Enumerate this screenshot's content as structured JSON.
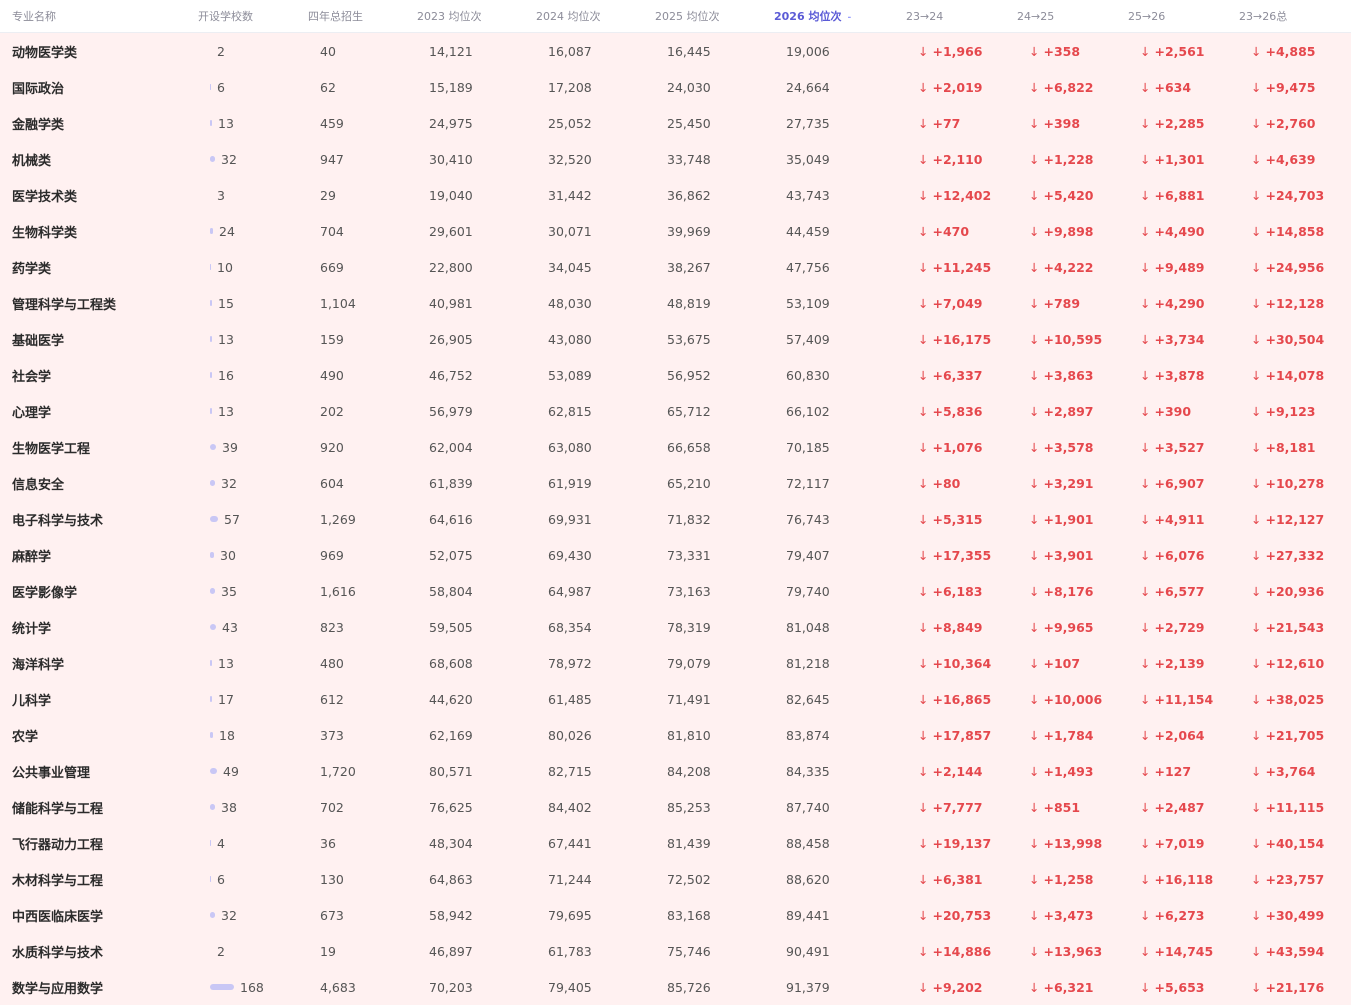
{
  "headers": [
    "专业名称",
    "开设学校数",
    "四年总招生",
    "2023 均位次",
    "2024 均位次",
    "2025 均位次",
    "2026 均位次",
    "23→24",
    "24→25",
    "25→26",
    "23→26总"
  ],
  "sort_indicator": "-",
  "rows": [
    {
      "name": "动物医学类",
      "schools": "2",
      "schools_n": 2,
      "total": "40",
      "r2023": "14,121",
      "r2024": "16,087",
      "r2025": "16,445",
      "r2026": "19,006",
      "d1": "+1,966",
      "d2": "+358",
      "d3": "+2,561",
      "d4": "+4,885"
    },
    {
      "name": "国际政治",
      "schools": "6",
      "schools_n": 6,
      "total": "62",
      "r2023": "15,189",
      "r2024": "17,208",
      "r2025": "24,030",
      "r2026": "24,664",
      "d1": "+2,019",
      "d2": "+6,822",
      "d3": "+634",
      "d4": "+9,475"
    },
    {
      "name": "金融学类",
      "schools": "13",
      "schools_n": 13,
      "total": "459",
      "r2023": "24,975",
      "r2024": "25,052",
      "r2025": "25,450",
      "r2026": "27,735",
      "d1": "+77",
      "d2": "+398",
      "d3": "+2,285",
      "d4": "+2,760"
    },
    {
      "name": "机械类",
      "schools": "32",
      "schools_n": 32,
      "total": "947",
      "r2023": "30,410",
      "r2024": "32,520",
      "r2025": "33,748",
      "r2026": "35,049",
      "d1": "+2,110",
      "d2": "+1,228",
      "d3": "+1,301",
      "d4": "+4,639"
    },
    {
      "name": "医学技术类",
      "schools": "3",
      "schools_n": 3,
      "total": "29",
      "r2023": "19,040",
      "r2024": "31,442",
      "r2025": "36,862",
      "r2026": "43,743",
      "d1": "+12,402",
      "d2": "+5,420",
      "d3": "+6,881",
      "d4": "+24,703"
    },
    {
      "name": "生物科学类",
      "schools": "24",
      "schools_n": 24,
      "total": "704",
      "r2023": "29,601",
      "r2024": "30,071",
      "r2025": "39,969",
      "r2026": "44,459",
      "d1": "+470",
      "d2": "+9,898",
      "d3": "+4,490",
      "d4": "+14,858"
    },
    {
      "name": "药学类",
      "schools": "10",
      "schools_n": 10,
      "total": "669",
      "r2023": "22,800",
      "r2024": "34,045",
      "r2025": "38,267",
      "r2026": "47,756",
      "d1": "+11,245",
      "d2": "+4,222",
      "d3": "+9,489",
      "d4": "+24,956"
    },
    {
      "name": "管理科学与工程类",
      "schools": "15",
      "schools_n": 15,
      "total": "1,104",
      "r2023": "40,981",
      "r2024": "48,030",
      "r2025": "48,819",
      "r2026": "53,109",
      "d1": "+7,049",
      "d2": "+789",
      "d3": "+4,290",
      "d4": "+12,128"
    },
    {
      "name": "基础医学",
      "schools": "13",
      "schools_n": 13,
      "total": "159",
      "r2023": "26,905",
      "r2024": "43,080",
      "r2025": "53,675",
      "r2026": "57,409",
      "d1": "+16,175",
      "d2": "+10,595",
      "d3": "+3,734",
      "d4": "+30,504"
    },
    {
      "name": "社会学",
      "schools": "16",
      "schools_n": 16,
      "total": "490",
      "r2023": "46,752",
      "r2024": "53,089",
      "r2025": "56,952",
      "r2026": "60,830",
      "d1": "+6,337",
      "d2": "+3,863",
      "d3": "+3,878",
      "d4": "+14,078"
    },
    {
      "name": "心理学",
      "schools": "13",
      "schools_n": 13,
      "total": "202",
      "r2023": "56,979",
      "r2024": "62,815",
      "r2025": "65,712",
      "r2026": "66,102",
      "d1": "+5,836",
      "d2": "+2,897",
      "d3": "+390",
      "d4": "+9,123"
    },
    {
      "name": "生物医学工程",
      "schools": "39",
      "schools_n": 39,
      "total": "920",
      "r2023": "62,004",
      "r2024": "63,080",
      "r2025": "66,658",
      "r2026": "70,185",
      "d1": "+1,076",
      "d2": "+3,578",
      "d3": "+3,527",
      "d4": "+8,181"
    },
    {
      "name": "信息安全",
      "schools": "32",
      "schools_n": 32,
      "total": "604",
      "r2023": "61,839",
      "r2024": "61,919",
      "r2025": "65,210",
      "r2026": "72,117",
      "d1": "+80",
      "d2": "+3,291",
      "d3": "+6,907",
      "d4": "+10,278"
    },
    {
      "name": "电子科学与技术",
      "schools": "57",
      "schools_n": 57,
      "total": "1,269",
      "r2023": "64,616",
      "r2024": "69,931",
      "r2025": "71,832",
      "r2026": "76,743",
      "d1": "+5,315",
      "d2": "+1,901",
      "d3": "+4,911",
      "d4": "+12,127"
    },
    {
      "name": "麻醉学",
      "schools": "30",
      "schools_n": 30,
      "total": "969",
      "r2023": "52,075",
      "r2024": "69,430",
      "r2025": "73,331",
      "r2026": "79,407",
      "d1": "+17,355",
      "d2": "+3,901",
      "d3": "+6,076",
      "d4": "+27,332"
    },
    {
      "name": "医学影像学",
      "schools": "35",
      "schools_n": 35,
      "total": "1,616",
      "r2023": "58,804",
      "r2024": "64,987",
      "r2025": "73,163",
      "r2026": "79,740",
      "d1": "+6,183",
      "d2": "+8,176",
      "d3": "+6,577",
      "d4": "+20,936"
    },
    {
      "name": "统计学",
      "schools": "43",
      "schools_n": 43,
      "total": "823",
      "r2023": "59,505",
      "r2024": "68,354",
      "r2025": "78,319",
      "r2026": "81,048",
      "d1": "+8,849",
      "d2": "+9,965",
      "d3": "+2,729",
      "d4": "+21,543"
    },
    {
      "name": "海洋科学",
      "schools": "13",
      "schools_n": 13,
      "total": "480",
      "r2023": "68,608",
      "r2024": "78,972",
      "r2025": "79,079",
      "r2026": "81,218",
      "d1": "+10,364",
      "d2": "+107",
      "d3": "+2,139",
      "d4": "+12,610"
    },
    {
      "name": "儿科学",
      "schools": "17",
      "schools_n": 17,
      "total": "612",
      "r2023": "44,620",
      "r2024": "61,485",
      "r2025": "71,491",
      "r2026": "82,645",
      "d1": "+16,865",
      "d2": "+10,006",
      "d3": "+11,154",
      "d4": "+38,025"
    },
    {
      "name": "农学",
      "schools": "18",
      "schools_n": 18,
      "total": "373",
      "r2023": "62,169",
      "r2024": "80,026",
      "r2025": "81,810",
      "r2026": "83,874",
      "d1": "+17,857",
      "d2": "+1,784",
      "d3": "+2,064",
      "d4": "+21,705"
    },
    {
      "name": "公共事业管理",
      "schools": "49",
      "schools_n": 49,
      "total": "1,720",
      "r2023": "80,571",
      "r2024": "82,715",
      "r2025": "84,208",
      "r2026": "84,335",
      "d1": "+2,144",
      "d2": "+1,493",
      "d3": "+127",
      "d4": "+3,764"
    },
    {
      "name": "储能科学与工程",
      "schools": "38",
      "schools_n": 38,
      "total": "702",
      "r2023": "76,625",
      "r2024": "84,402",
      "r2025": "85,253",
      "r2026": "87,740",
      "d1": "+7,777",
      "d2": "+851",
      "d3": "+2,487",
      "d4": "+11,115"
    },
    {
      "name": "飞行器动力工程",
      "schools": "4",
      "schools_n": 4,
      "total": "36",
      "r2023": "48,304",
      "r2024": "67,441",
      "r2025": "81,439",
      "r2026": "88,458",
      "d1": "+19,137",
      "d2": "+13,998",
      "d3": "+7,019",
      "d4": "+40,154"
    },
    {
      "name": "木材科学与工程",
      "schools": "6",
      "schools_n": 6,
      "total": "130",
      "r2023": "64,863",
      "r2024": "71,244",
      "r2025": "72,502",
      "r2026": "88,620",
      "d1": "+6,381",
      "d2": "+1,258",
      "d3": "+16,118",
      "d4": "+23,757"
    },
    {
      "name": "中西医临床医学",
      "schools": "32",
      "schools_n": 32,
      "total": "673",
      "r2023": "58,942",
      "r2024": "79,695",
      "r2025": "83,168",
      "r2026": "89,441",
      "d1": "+20,753",
      "d2": "+3,473",
      "d3": "+6,273",
      "d4": "+30,499"
    },
    {
      "name": "水质科学与技术",
      "schools": "2",
      "schools_n": 2,
      "total": "19",
      "r2023": "46,897",
      "r2024": "61,783",
      "r2025": "75,746",
      "r2026": "90,491",
      "d1": "+14,886",
      "d2": "+13,963",
      "d3": "+14,745",
      "d4": "+43,594"
    },
    {
      "name": "数学与应用数学",
      "schools": "168",
      "schools_n": 168,
      "total": "4,683",
      "r2023": "70,203",
      "r2024": "79,405",
      "r2025": "85,726",
      "r2026": "91,379",
      "d1": "+9,202",
      "d2": "+6,321",
      "d3": "+5,653",
      "d4": "+21,176"
    }
  ],
  "arrow_glyph": "↓",
  "colors": {
    "delta": "#e5484d",
    "bar": "#c9c7f5",
    "row_bg": "#fff1f1",
    "sorted_header": "#5b5bd6"
  }
}
